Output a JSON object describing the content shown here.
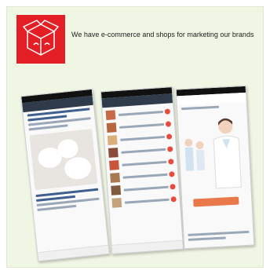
{
  "headline": "We have e-commerce and shops for marketing our brands",
  "colors": {
    "accent": "#e31e24",
    "card_bg": "#f0f6e4"
  },
  "icon": "open-box-icon"
}
